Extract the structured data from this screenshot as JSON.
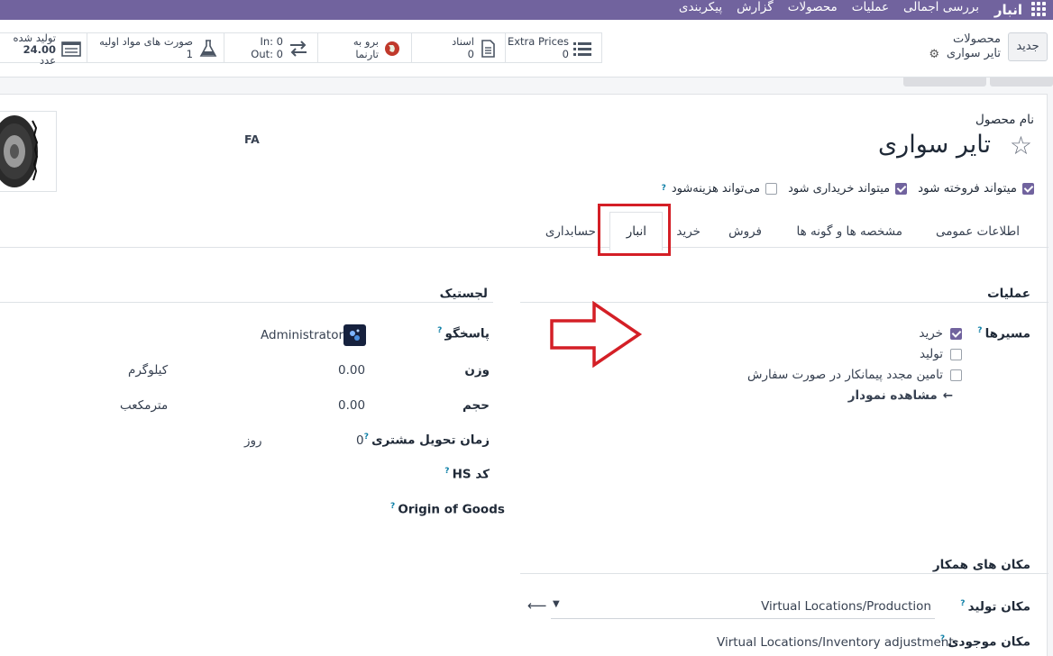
{
  "navbar": {
    "app_name": "انبار",
    "menu": [
      "بررسی اجمالی",
      "عملیات",
      "محصولات",
      "گزارش",
      "پیکربندی"
    ]
  },
  "control_panel": {
    "new_button": "جدید",
    "breadcrumb_parent": "محصولات",
    "breadcrumb_current": "تایر سواری"
  },
  "stats": [
    {
      "label": "Extra Prices",
      "value": "0",
      "icon": "list-icon"
    },
    {
      "label": "اسناد",
      "value": "0",
      "icon": "document-icon"
    },
    {
      "label": "برو به",
      "value": "تارنما",
      "icon": "globe-icon"
    },
    {
      "label": "In: 0",
      "value": "Out: 0",
      "icon": "transfer-arrows-icon"
    },
    {
      "label": "صورت های مواد اولیه",
      "value": "1",
      "icon": "flask-icon"
    },
    {
      "label": "تولید شده",
      "value": "24.00",
      "extra": "عدد",
      "icon": "bom-icon"
    }
  ],
  "product": {
    "name_label": "نام محصول",
    "name": "تایر سواری",
    "lang": "FA",
    "options": [
      {
        "label": "میتواند فروخته شود",
        "checked": true
      },
      {
        "label": "میتواند خریداری شود",
        "checked": true
      },
      {
        "label": "می‌تواند هزینه‌شود",
        "checked": false
      }
    ]
  },
  "tabs": [
    "اطلاعات عمومی",
    "مشخصه ها و گونه ها",
    "فروش",
    "خرید",
    "انبار",
    "حسابداری"
  ],
  "active_tab": "انبار",
  "operations": {
    "title": "عملیات",
    "routes_label": "مسیرها",
    "routes": [
      {
        "label": "خرید",
        "checked": true
      },
      {
        "label": "تولید",
        "checked": false
      },
      {
        "label": "تامین مجدد پیمانکار در صورت سفارش",
        "checked": false
      }
    ],
    "view_diagram": "مشاهده نمودار"
  },
  "logistics": {
    "title": "لجستیک",
    "responsible_label": "پاسخگو",
    "responsible_value": "Administrator",
    "weight_label": "وزن",
    "weight_value": "0.00",
    "weight_unit": "کیلوگرم",
    "volume_label": "حجم",
    "volume_value": "0.00",
    "volume_unit": "مترمکعب",
    "lead_label": "زمان تحویل مشتری",
    "lead_value": "0",
    "lead_unit": "روز",
    "hs_label": "کد HS",
    "origin_label": "Origin of Goods"
  },
  "counterpart": {
    "title": "مکان های همکار",
    "production_label": "مکان تولید",
    "production_value": "Virtual Locations/Production",
    "inventory_label": "مکان موجودی",
    "inventory_value": "Virtual Locations/Inventory adjustment"
  },
  "colors": {
    "navbar": "#71639e",
    "checkbox": "#71639e",
    "highlight": "#d41f26"
  }
}
